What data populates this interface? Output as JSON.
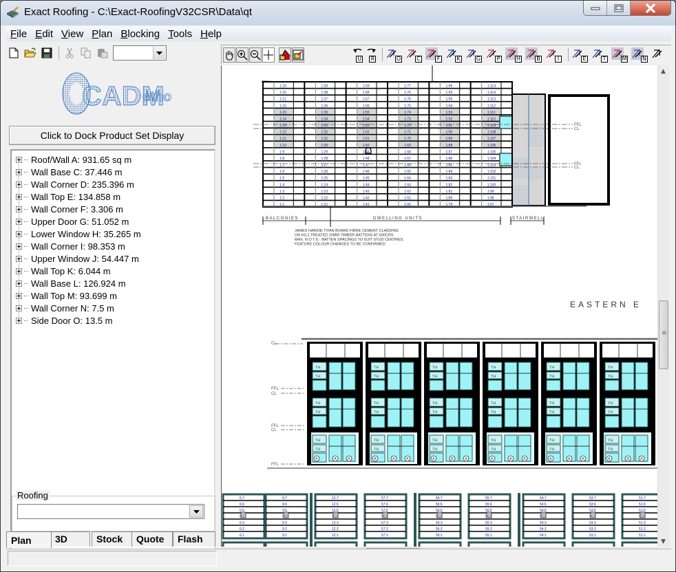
{
  "window": {
    "title": "Exact Roofing - C:\\Exact-RoofingV32CSR\\Data\\qt",
    "controls": [
      "minimize",
      "maximize",
      "close"
    ]
  },
  "menu": {
    "items": [
      {
        "label": "File",
        "accel": "F",
        "rest": "ile"
      },
      {
        "label": "Edit",
        "accel": "E",
        "rest": "dit"
      },
      {
        "label": "View",
        "accel": "V",
        "rest": "iew"
      },
      {
        "label": "Plan",
        "accel": "P",
        "rest": "lan"
      },
      {
        "label": "Blocking",
        "accel": "B",
        "rest": "locking"
      },
      {
        "label": "Tools",
        "accel": "T",
        "rest": "ools"
      },
      {
        "label": "Help",
        "accel": "H",
        "rest": "elp"
      }
    ]
  },
  "toolbar_left": {
    "icons": [
      "new-file-icon",
      "open-folder-icon",
      "save-icon",
      "cut-icon",
      "copy-icon",
      "paste-icon"
    ],
    "combo_value": ""
  },
  "toolbar_right": {
    "view_tools": [
      "pan-hand-icon",
      "zoom-in-icon",
      "zoom-out-icon",
      "crosshair-icon"
    ],
    "shape_tools": [
      "shapes-icon",
      "picture-frame-icon"
    ],
    "undo_label": "U",
    "redo_label": "R",
    "tools": [
      {
        "name": "tool-o",
        "letter": "O"
      },
      {
        "name": "tool-c",
        "letter": "C"
      },
      {
        "name": "tool-f",
        "letter": "F"
      },
      {
        "name": "tool-k",
        "letter": "K"
      },
      {
        "name": "tool-g",
        "letter": "G"
      },
      {
        "name": "tool-p",
        "letter": "P"
      },
      {
        "name": "tool-h",
        "letter": "H"
      },
      {
        "name": "tool-b",
        "letter": "B"
      },
      {
        "name": "tool-i",
        "letter": "I"
      },
      {
        "name": "tool-e",
        "letter": "E"
      },
      {
        "name": "tool-t",
        "letter": "T"
      },
      {
        "name": "tool-m",
        "letter": "M"
      },
      {
        "name": "tool-n",
        "letter": "N"
      },
      {
        "name": "tool-extra",
        "letter": ""
      }
    ]
  },
  "left_panel": {
    "logo_text": "CADMethods",
    "dock_button": "Click to Dock Product Set Display",
    "tree_items": [
      "Roof/Wall A: 931.65 sq m",
      "Wall Base C: 37.446 m",
      "Wall Corner D: 235.396 m",
      "Wall Top E: 134.858 m",
      "Wall Corner F: 3.306 m",
      "Upper Door G: 51.052 m",
      "Lower Window H: 35.265 m",
      "Wall Corner I: 98.353 m",
      "Upper Window J: 54.447 m",
      "Wall Top K: 6.044 m",
      "Wall Base L: 126.924 m",
      "Wall Top M: 93.699 m",
      "Wall Corner N: 7.5 m",
      "Side Door O: 13.5 m"
    ],
    "group_label": "Roofing",
    "group_combo_value": ""
  },
  "tabs": [
    {
      "label": "Plan",
      "active": true
    },
    {
      "label": "3D",
      "active": false
    },
    {
      "label": "Stock",
      "active": false
    },
    {
      "label": "Quote",
      "active": false
    },
    {
      "label": "Flash",
      "active": false
    }
  ],
  "drawing": {
    "dimension_labels": [
      "BALCONIES",
      "DWELLING  UNITS",
      "STAIRWELL"
    ],
    "note_lines": [
      "JAMES HARDIE TITAN BOARD FIBRE CEMENT CLADDING",
      "ON H3.2 TREATED 20MM TIMBER BATTENS AT 600CRS",
      "MAX. N O T E : BATTEN SPACINGS TO SUIT STUD CENTRES.",
      "FEATURE COLOUR CHANGES TO BE CONFIRMED"
    ],
    "section_title": "EASTERN  E",
    "level_labels": {
      "ffl": "FFL",
      "cl": "CL"
    },
    "window_tag": "TH",
    "door_tag": "A",
    "upper_columns": [
      [
        "1:16",
        "1:15",
        "1:11",
        "1:16",
        "1:15",
        "1:14",
        "1:13",
        "1:12",
        "1:11",
        "1:10",
        "1:9",
        "1:8",
        "1:7",
        "1:6",
        "1:5",
        "1:4",
        "1:3",
        "1:2",
        "1:1"
      ],
      [
        "1:39",
        "1:38",
        "1:37",
        "1:36",
        "1:35",
        "1:34",
        "1:33",
        "1:32",
        "1:31",
        "1:30",
        "1:29",
        "1:28",
        "1:27",
        "1:26",
        "1:25",
        "1:24",
        "1:23",
        "1:22",
        "1:21"
      ],
      [
        "1:59",
        "1:58",
        "1:57",
        "1:56",
        "1:55",
        "1:54",
        "1:53",
        "1:52",
        "1:51",
        "1:50",
        "1:49",
        "1:48",
        "1:47",
        "1:46",
        "1:45",
        "1:44",
        "1:43",
        "1:42",
        "1:41"
      ],
      [
        "1:77",
        "1:76",
        "1:76",
        "1:75",
        "1:74",
        "1:73",
        "1:72",
        "1:71",
        "1:70",
        "1:69",
        "1:68",
        "1:67",
        "1:66",
        "1:65",
        "1:64",
        "1:63",
        "1:62",
        "1:61",
        "1:60"
      ],
      [
        "1:96",
        "1:95",
        "1:95",
        "1:94",
        "1:93",
        "1:92",
        "1:91",
        "1:90",
        "1:89",
        "1:88",
        "1:87",
        "1:86",
        "1:85",
        "1:84",
        "1:83",
        "1:82",
        "1:81",
        "1:80",
        "1:79"
      ],
      [
        "1:114",
        "1:114",
        "1:113",
        "1:112",
        "1:111",
        "1:110",
        "1:109",
        "1:108",
        "1:107",
        "1:106",
        "1:105",
        "1:104",
        "1:103",
        "1:102",
        "1:101",
        "1:100",
        "1:99",
        "1:98",
        "1:97"
      ]
    ],
    "lower_panels": [
      [
        "6:7",
        "6:6",
        "6:5",
        "6:4",
        "6:3",
        "6:2",
        "6:1"
      ],
      [
        "9:7",
        "9:6",
        "9:5",
        "9:4",
        "9:3",
        "9:2",
        "9:1"
      ],
      [
        "12:7",
        "12:6",
        "12:5",
        "12:4",
        "12:3",
        "12:2",
        "12:1"
      ],
      [
        "57:7",
        "57:6",
        "57:5",
        "57:4",
        "57:3",
        "57:2",
        "57:1"
      ],
      [
        "56:7",
        "56:6",
        "56:5",
        "56:4",
        "56:3",
        "56:2",
        "56:1"
      ],
      [
        "55:7",
        "55:6",
        "55:5",
        "55:4",
        "55:3",
        "55:2",
        "55:1"
      ],
      [
        "54:7",
        "54:6",
        "54:5",
        "54:4",
        "54:3",
        "54:2",
        "54:1"
      ],
      [
        "53:7",
        "53:6",
        "53:5",
        "53:4",
        "53:3",
        "53:2",
        "53:1"
      ],
      [
        "51:7",
        "51:6",
        "51:5",
        "51:4",
        "51:3",
        "51:2",
        "51:1"
      ]
    ]
  },
  "colors": {
    "glass": "#9ff3f7",
    "label_blue": "#1a1a9a",
    "panel_grey": "#d6d6d6",
    "frame": "#000000",
    "frame_teal": "#2e5656",
    "close_red": "#c5412b"
  }
}
